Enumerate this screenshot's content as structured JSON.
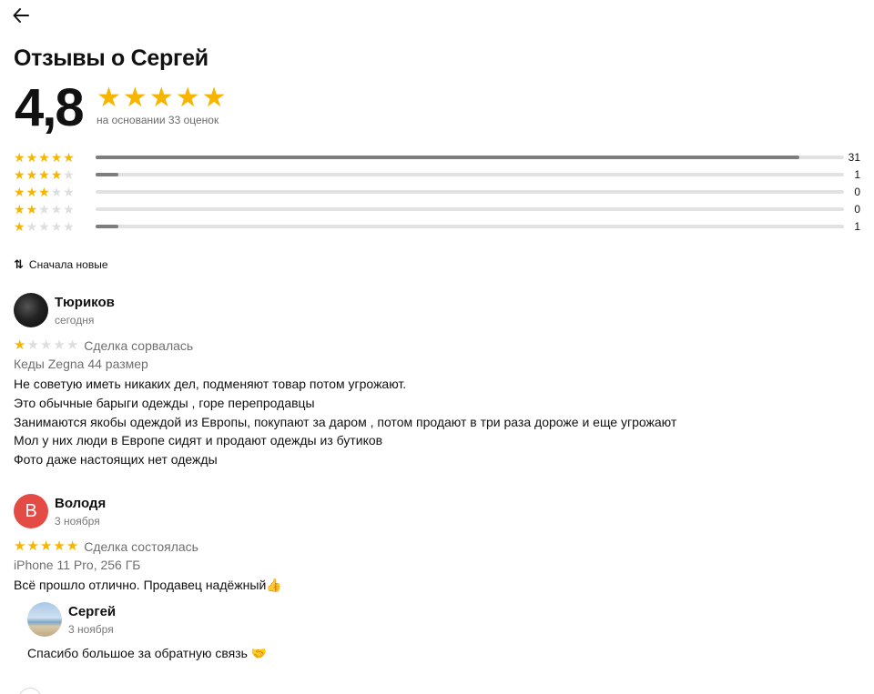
{
  "header": {
    "back_icon": "arrow-left-icon",
    "title": "Отзывы о Сергей"
  },
  "summary": {
    "rating": "4,8",
    "stars": 5,
    "basis": "на основании 33 оценок",
    "star_color": "#f7b500"
  },
  "distribution": [
    {
      "stars": 5,
      "count": "31",
      "fraction": 0.94
    },
    {
      "stars": 4,
      "count": "1",
      "fraction": 0.03
    },
    {
      "stars": 3,
      "count": "0",
      "fraction": 0
    },
    {
      "stars": 2,
      "count": "0",
      "fraction": 0
    },
    {
      "stars": 1,
      "count": "1",
      "fraction": 0.03
    }
  ],
  "sort": {
    "icon": "sort-arrows-icon",
    "label": "Сначала новые"
  },
  "reviews": [
    {
      "name": "Тюриков",
      "date": "сегодня",
      "stars": 1,
      "status": "Сделка сорвалась",
      "item": "Кеды Zegna 44 размер",
      "text": "Не советую иметь никаких дел, подменяют товар потом угрожают.\nЭто обычные барыги одежды , горе перепродавцы\nЗанимаются якобы одеждой из Европы, покупают за даром , потом продают в три раза дороже и еще угрожают\nМол у них люди в Европе сидят и продают одежды из бутиков\nФото даже настоящих нет одежды"
    },
    {
      "name": "Володя",
      "avatar_letter": "В",
      "avatar_color": "#e54b45",
      "date": "3 ноября",
      "stars": 5,
      "status": "Сделка состоялась",
      "item": "iPhone 11 Pro, 256 ГБ",
      "text": "Всё прошло отлично. Продавец надёжный👍",
      "reply": {
        "name": "Сергей",
        "date": "3 ноября",
        "text": "Спасибо большое за обратную связь 🤝"
      }
    }
  ]
}
